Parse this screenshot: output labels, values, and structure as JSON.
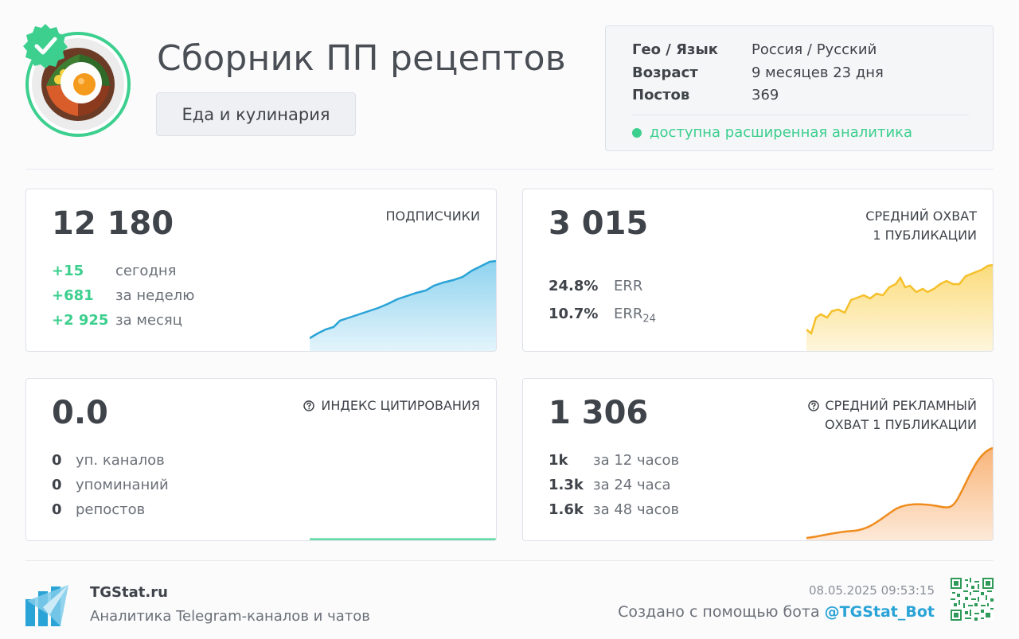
{
  "channel": {
    "title": "Сборник ПП рецептов",
    "category": "Еда и кулинария",
    "avatar_icon": "food-plate-avatar",
    "verified_icon": "verified-check-badge"
  },
  "info": {
    "rows": [
      {
        "key": "Гео / Язык",
        "value": "Россия / Русский"
      },
      {
        "key": "Возраст",
        "value": "9 месяцев 23 дня"
      },
      {
        "key": "Постов",
        "value": "369"
      }
    ],
    "analytics": "доступна расширенная аналитика"
  },
  "subscribers": {
    "value": "12 180",
    "label": "ПОДПИСЧИКИ",
    "stats": [
      {
        "value": "+15",
        "label": "сегодня"
      },
      {
        "value": "+681",
        "label": "за неделю"
      },
      {
        "value": "+2 925",
        "label": "за месяц"
      }
    ],
    "color": "#2aa3d6"
  },
  "reach": {
    "value": "3 015",
    "label_line1": "СРЕДНИЙ ОХВАТ",
    "label_line2": "1 ПУБЛИКАЦИИ",
    "err": {
      "value": "24.8%",
      "label": "ERR"
    },
    "err24": {
      "value": "10.7%",
      "label": "ERR",
      "sub": "24"
    },
    "color": "#f5c02a"
  },
  "citation": {
    "value": "0.0",
    "label": "ИНДЕКС ЦИТИРОВАНИЯ",
    "stats": [
      {
        "value": "0",
        "label": "уп. каналов"
      },
      {
        "value": "0",
        "label": "упоминаний"
      },
      {
        "value": "0",
        "label": "репостов"
      }
    ],
    "color": "#3ccf8e"
  },
  "ad_reach": {
    "value": "1 306",
    "label_line1": "СРЕДНИЙ РЕКЛАМНЫЙ",
    "label_line2": "ОХВАТ 1 ПУБЛИКАЦИИ",
    "stats": [
      {
        "value": "1k",
        "label": "за 12 часов"
      },
      {
        "value": "1.3k",
        "label": "за 24 часа"
      },
      {
        "value": "1.6k",
        "label": "за 48 часов"
      }
    ],
    "color": "#f08c1e"
  },
  "footer": {
    "brand": "TGStat.ru",
    "tagline": "Аналитика Telegram-каналов и чатов",
    "timestamp": "08.05.2025 09:53:15",
    "created_prefix": "Создано с помощью бота",
    "bot": "@TGStat_Bot"
  }
}
